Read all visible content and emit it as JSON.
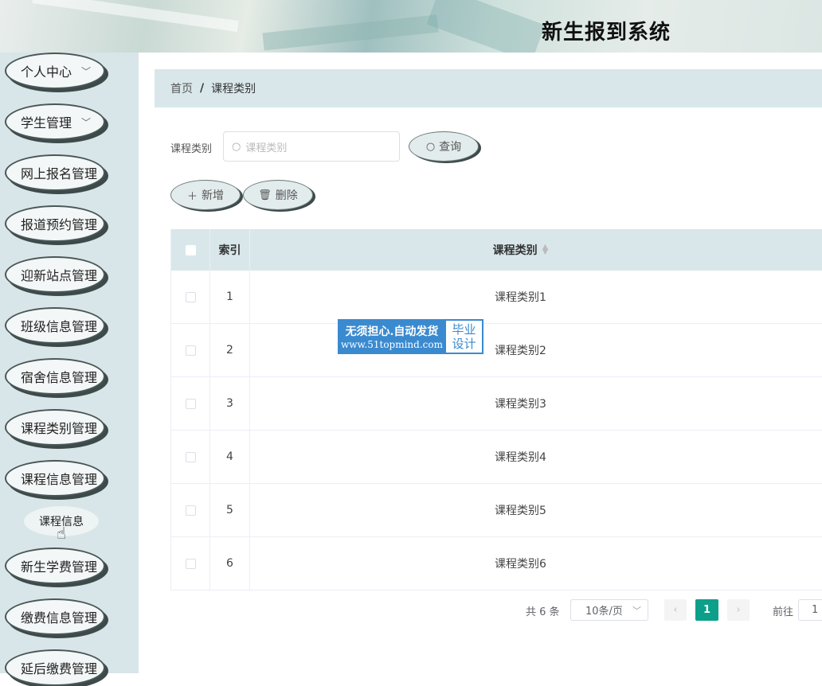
{
  "header": {
    "title": "新生报到系统"
  },
  "sidebar": {
    "items": [
      {
        "label": "个人中心",
        "chevron": true
      },
      {
        "label": "学生管理",
        "chevron": true
      },
      {
        "label": "网上报名管理",
        "chevron": false
      },
      {
        "label": "报道预约管理",
        "chevron": false
      },
      {
        "label": "迎新站点管理",
        "chevron": false
      },
      {
        "label": "班级信息管理",
        "chevron": false
      },
      {
        "label": "宿舍信息管理",
        "chevron": false
      },
      {
        "label": "课程类别管理",
        "chevron": false
      },
      {
        "label": "课程信息管理",
        "chevron": false
      },
      {
        "label": "新生学费管理",
        "chevron": false
      },
      {
        "label": "缴费信息管理",
        "chevron": false
      },
      {
        "label": "延后缴费管理",
        "chevron": false
      }
    ],
    "submenu": {
      "label": "课程信息"
    }
  },
  "breadcrumb": {
    "home": "首页",
    "separator": "/",
    "current": "课程类别"
  },
  "search": {
    "label": "课程类别",
    "placeholder": "课程类别",
    "query_button": "查询"
  },
  "actions": {
    "add": "新增",
    "delete": "删除"
  },
  "table": {
    "headers": {
      "index": "索引",
      "category": "课程类别"
    },
    "rows": [
      {
        "index": "1",
        "category": "课程类别1"
      },
      {
        "index": "2",
        "category": "课程类别2"
      },
      {
        "index": "3",
        "category": "课程类别3"
      },
      {
        "index": "4",
        "category": "课程类别4"
      },
      {
        "index": "5",
        "category": "课程类别5"
      },
      {
        "index": "6",
        "category": "课程类别6"
      }
    ]
  },
  "watermark": {
    "line1": "无须担心.自动发货",
    "line2": "www.51topmind.com",
    "right1": "毕业",
    "right2": "设计"
  },
  "pagination": {
    "total": "共 6 条",
    "page_size": "10条/页",
    "current": "1",
    "goto_label": "前往",
    "goto_value": "1"
  },
  "colors": {
    "accent": "#0c9f8a",
    "header_bg": "#d9e7eb",
    "sidebar_bg": "#d8e5e9"
  }
}
